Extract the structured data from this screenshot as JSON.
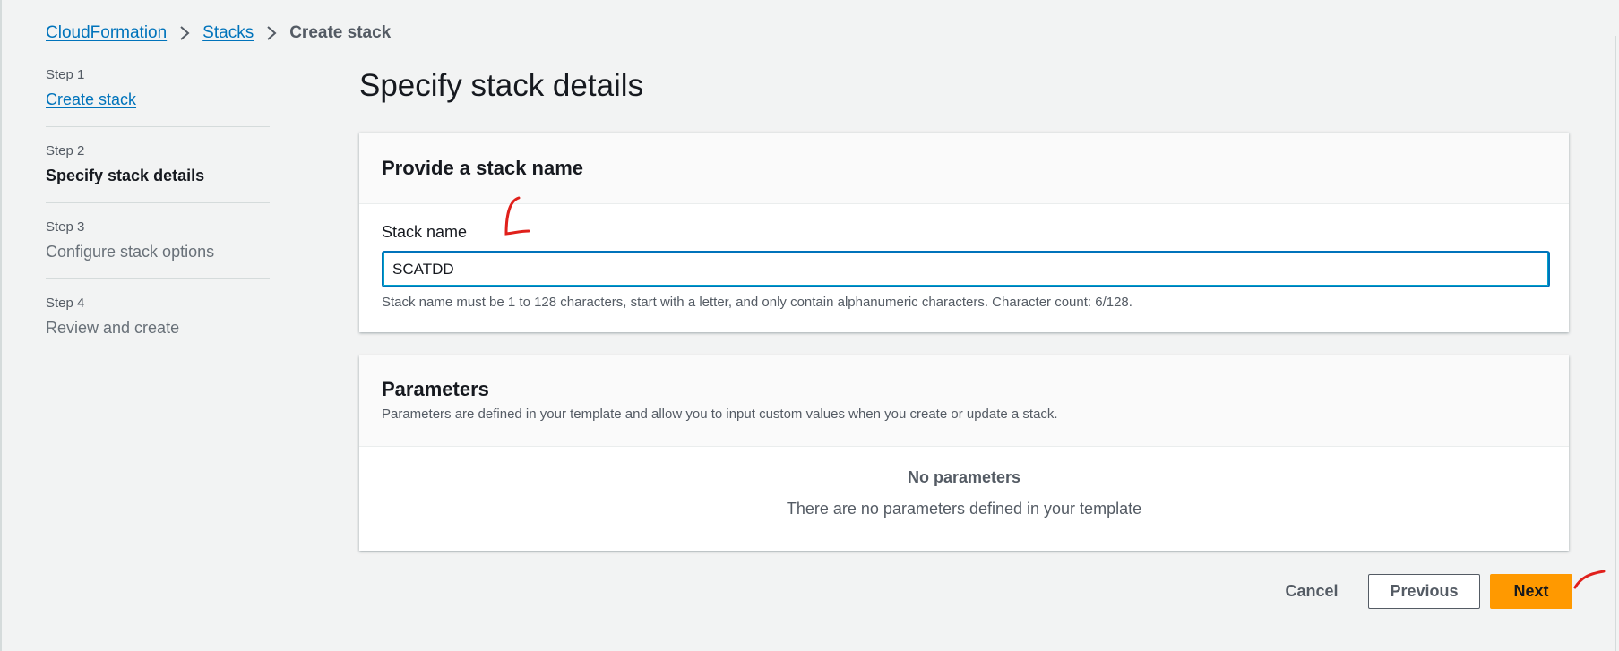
{
  "breadcrumb": {
    "items": [
      {
        "label": "CloudFormation",
        "link": true
      },
      {
        "label": "Stacks",
        "link": true
      },
      {
        "label": "Create stack",
        "link": false
      }
    ]
  },
  "steps": [
    {
      "num": "Step 1",
      "label": "Create stack",
      "state": "link"
    },
    {
      "num": "Step 2",
      "label": "Specify stack details",
      "state": "active"
    },
    {
      "num": "Step 3",
      "label": "Configure stack options",
      "state": "muted"
    },
    {
      "num": "Step 4",
      "label": "Review and create",
      "state": "muted"
    }
  ],
  "page_title": "Specify stack details",
  "stack_name_panel": {
    "title": "Provide a stack name",
    "field_label": "Stack name",
    "value": "SCATDD",
    "hint": "Stack name must be 1 to 128 characters, start with a letter, and only contain alphanumeric characters. Character count: 6/128."
  },
  "parameters_panel": {
    "title": "Parameters",
    "description": "Parameters are defined in your template and allow you to input custom values when you create or update a stack.",
    "empty_title": "No parameters",
    "empty_description": "There are no parameters defined in your template"
  },
  "actions": {
    "cancel": "Cancel",
    "previous": "Previous",
    "next": "Next"
  },
  "colors": {
    "link": "#0073bb",
    "primary_button": "#ff9900",
    "background": "#f2f3f3",
    "annotation": "#e0201b"
  }
}
